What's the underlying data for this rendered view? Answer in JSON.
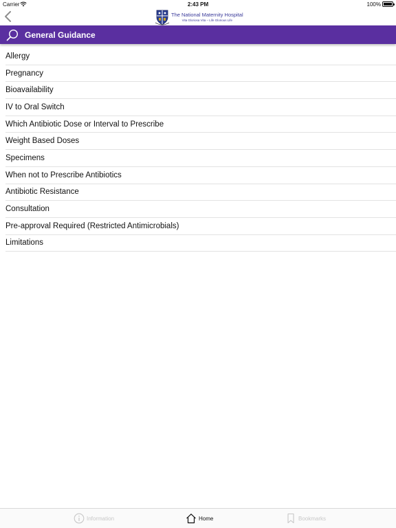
{
  "status_bar": {
    "carrier": "Carrier",
    "time": "2:43 PM",
    "battery": "100%"
  },
  "nav": {
    "logo_name": "The National Maternity Hospital",
    "logo_motto": "Vita Gloriosa Vita – Life Glorious Life",
    "back_icon": "chevron-left-icon"
  },
  "header": {
    "title": "General Guidance",
    "icon": "search-icon",
    "color": "#5a2fa0"
  },
  "list": {
    "items": [
      "Allergy",
      "Pregnancy",
      "Bioavailability",
      "IV to Oral Switch",
      "Which Antibiotic Dose or Interval to Prescribe",
      "Weight Based Doses",
      "Specimens",
      "When not to Prescribe Antibiotics",
      "Antibiotic Resistance",
      "Consultation",
      "Pre-approval Required (Restricted Antimicrobials)",
      "Limitations"
    ]
  },
  "tabs": {
    "information": "Information",
    "home": "Home",
    "bookmarks": "Bookmarks"
  }
}
